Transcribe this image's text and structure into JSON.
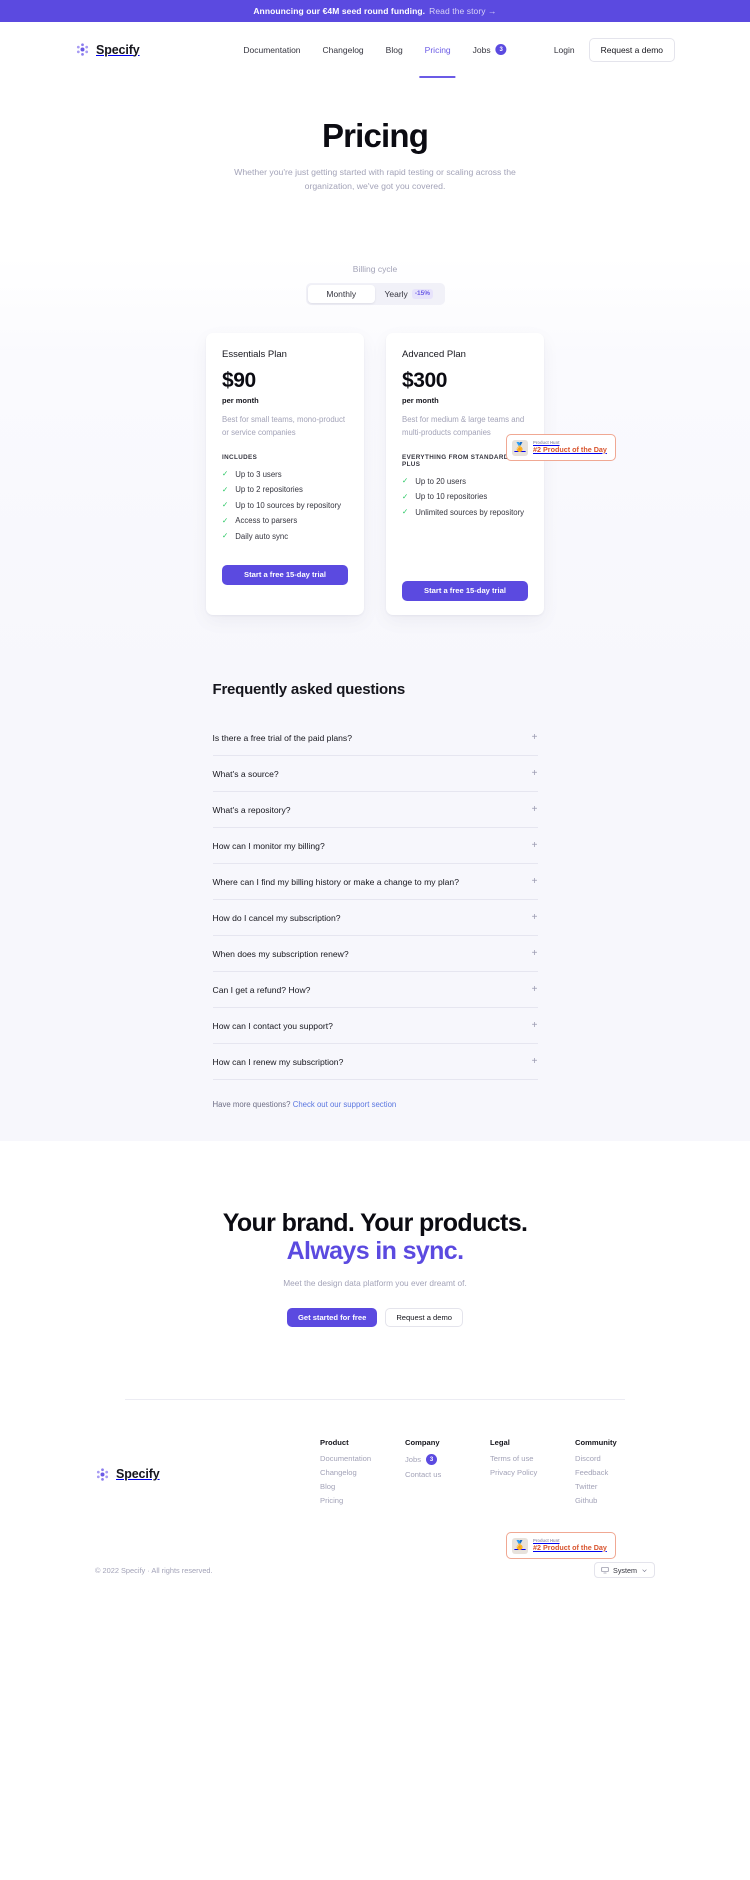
{
  "announcement": {
    "text": "Announcing our €4M seed round funding.",
    "link": "Read the story →"
  },
  "brand": {
    "name": "Specify",
    "logo_icon": "specify-logo-icon"
  },
  "nav": {
    "links": [
      {
        "label": "Documentation",
        "active": false
      },
      {
        "label": "Changelog",
        "active": false
      },
      {
        "label": "Blog",
        "active": false
      },
      {
        "label": "Pricing",
        "active": true
      },
      {
        "label": "Jobs",
        "badge": "3",
        "active": false
      }
    ],
    "login_label": "Login",
    "demo_label": "Request a demo"
  },
  "hero": {
    "title": "Pricing",
    "subtitle": "Whether you're just getting started with rapid testing or scaling across the organization, we've got you covered."
  },
  "billing": {
    "label": "Billing cycle",
    "options": [
      {
        "label": "Monthly",
        "selected": true
      },
      {
        "label": "Yearly",
        "badge": "-15%",
        "selected": false
      }
    ]
  },
  "plans": [
    {
      "name": "Essentials Plan",
      "price": "$90",
      "period": "per month",
      "description": "Best for small teams, mono-product or service companies",
      "includes_label": "INCLUDES",
      "features": [
        "Up to 3 users",
        "Up to 2 repositories",
        "Up to 10 sources by repository",
        "Access to parsers",
        "Daily auto sync"
      ],
      "cta": "Start a free 15-day trial"
    },
    {
      "name": "Advanced Plan",
      "price": "$300",
      "period": "per month",
      "description": "Best for medium & large teams and multi-products companies",
      "includes_label": "EVERYTHING FROM STANDARD, PLUS",
      "features": [
        "Up to 20 users",
        "Up to 10 repositories",
        "Unlimited sources by repository"
      ],
      "cta": "Start a free 15-day trial"
    }
  ],
  "faq": {
    "title": "Frequently asked questions",
    "items": [
      "Is there a free trial of the paid plans?",
      "What's a source?",
      "What's a repository?",
      "How can I monitor my billing?",
      "Where can I find my billing history or make a change to my plan?",
      "How do I cancel my subscription?",
      "When does my subscription renew?",
      "Can I get a refund? How?",
      "How can I contact you support?",
      "How can I renew my subscription?"
    ],
    "more_text": "Have more questions?",
    "more_link": "Check out our support section",
    "expand_icon": "plus-icon"
  },
  "cta_section": {
    "line1": "Your brand. Your products.",
    "line2": "Always in sync.",
    "subtitle": "Meet the design data platform you ever dreamt of.",
    "primary": "Get started for free",
    "secondary": "Request a demo"
  },
  "footer": {
    "columns": [
      {
        "title": "Product",
        "links": [
          {
            "label": "Documentation"
          },
          {
            "label": "Changelog"
          },
          {
            "label": "Blog"
          },
          {
            "label": "Pricing"
          }
        ]
      },
      {
        "title": "Company",
        "links": [
          {
            "label": "Jobs",
            "badge": "3"
          },
          {
            "label": "Contact us"
          }
        ]
      },
      {
        "title": "Legal",
        "links": [
          {
            "label": "Terms of use"
          },
          {
            "label": "Privacy Policy"
          }
        ]
      },
      {
        "title": "Community",
        "links": [
          {
            "label": "Discord"
          },
          {
            "label": "Feedback"
          },
          {
            "label": "Twitter"
          },
          {
            "label": "Github"
          }
        ]
      }
    ],
    "copyright": "© 2022 Specify · All rights reserved.",
    "theme": {
      "label": "System",
      "icon": "monitor-icon",
      "chevron": "chevron-down-icon"
    }
  },
  "product_hunt": {
    "kicker": "Product Hunt",
    "text": "#2 Product of the Day",
    "avatar_icon": "product-hunt-avatar-icon"
  },
  "colors": {
    "brand": "#5B4AE0",
    "accent_text": "#6B5BE6",
    "muted": "#A3A3B8",
    "check": "#22C55E",
    "ph_border": "#F0A893",
    "ph_text": "#D8542E"
  }
}
